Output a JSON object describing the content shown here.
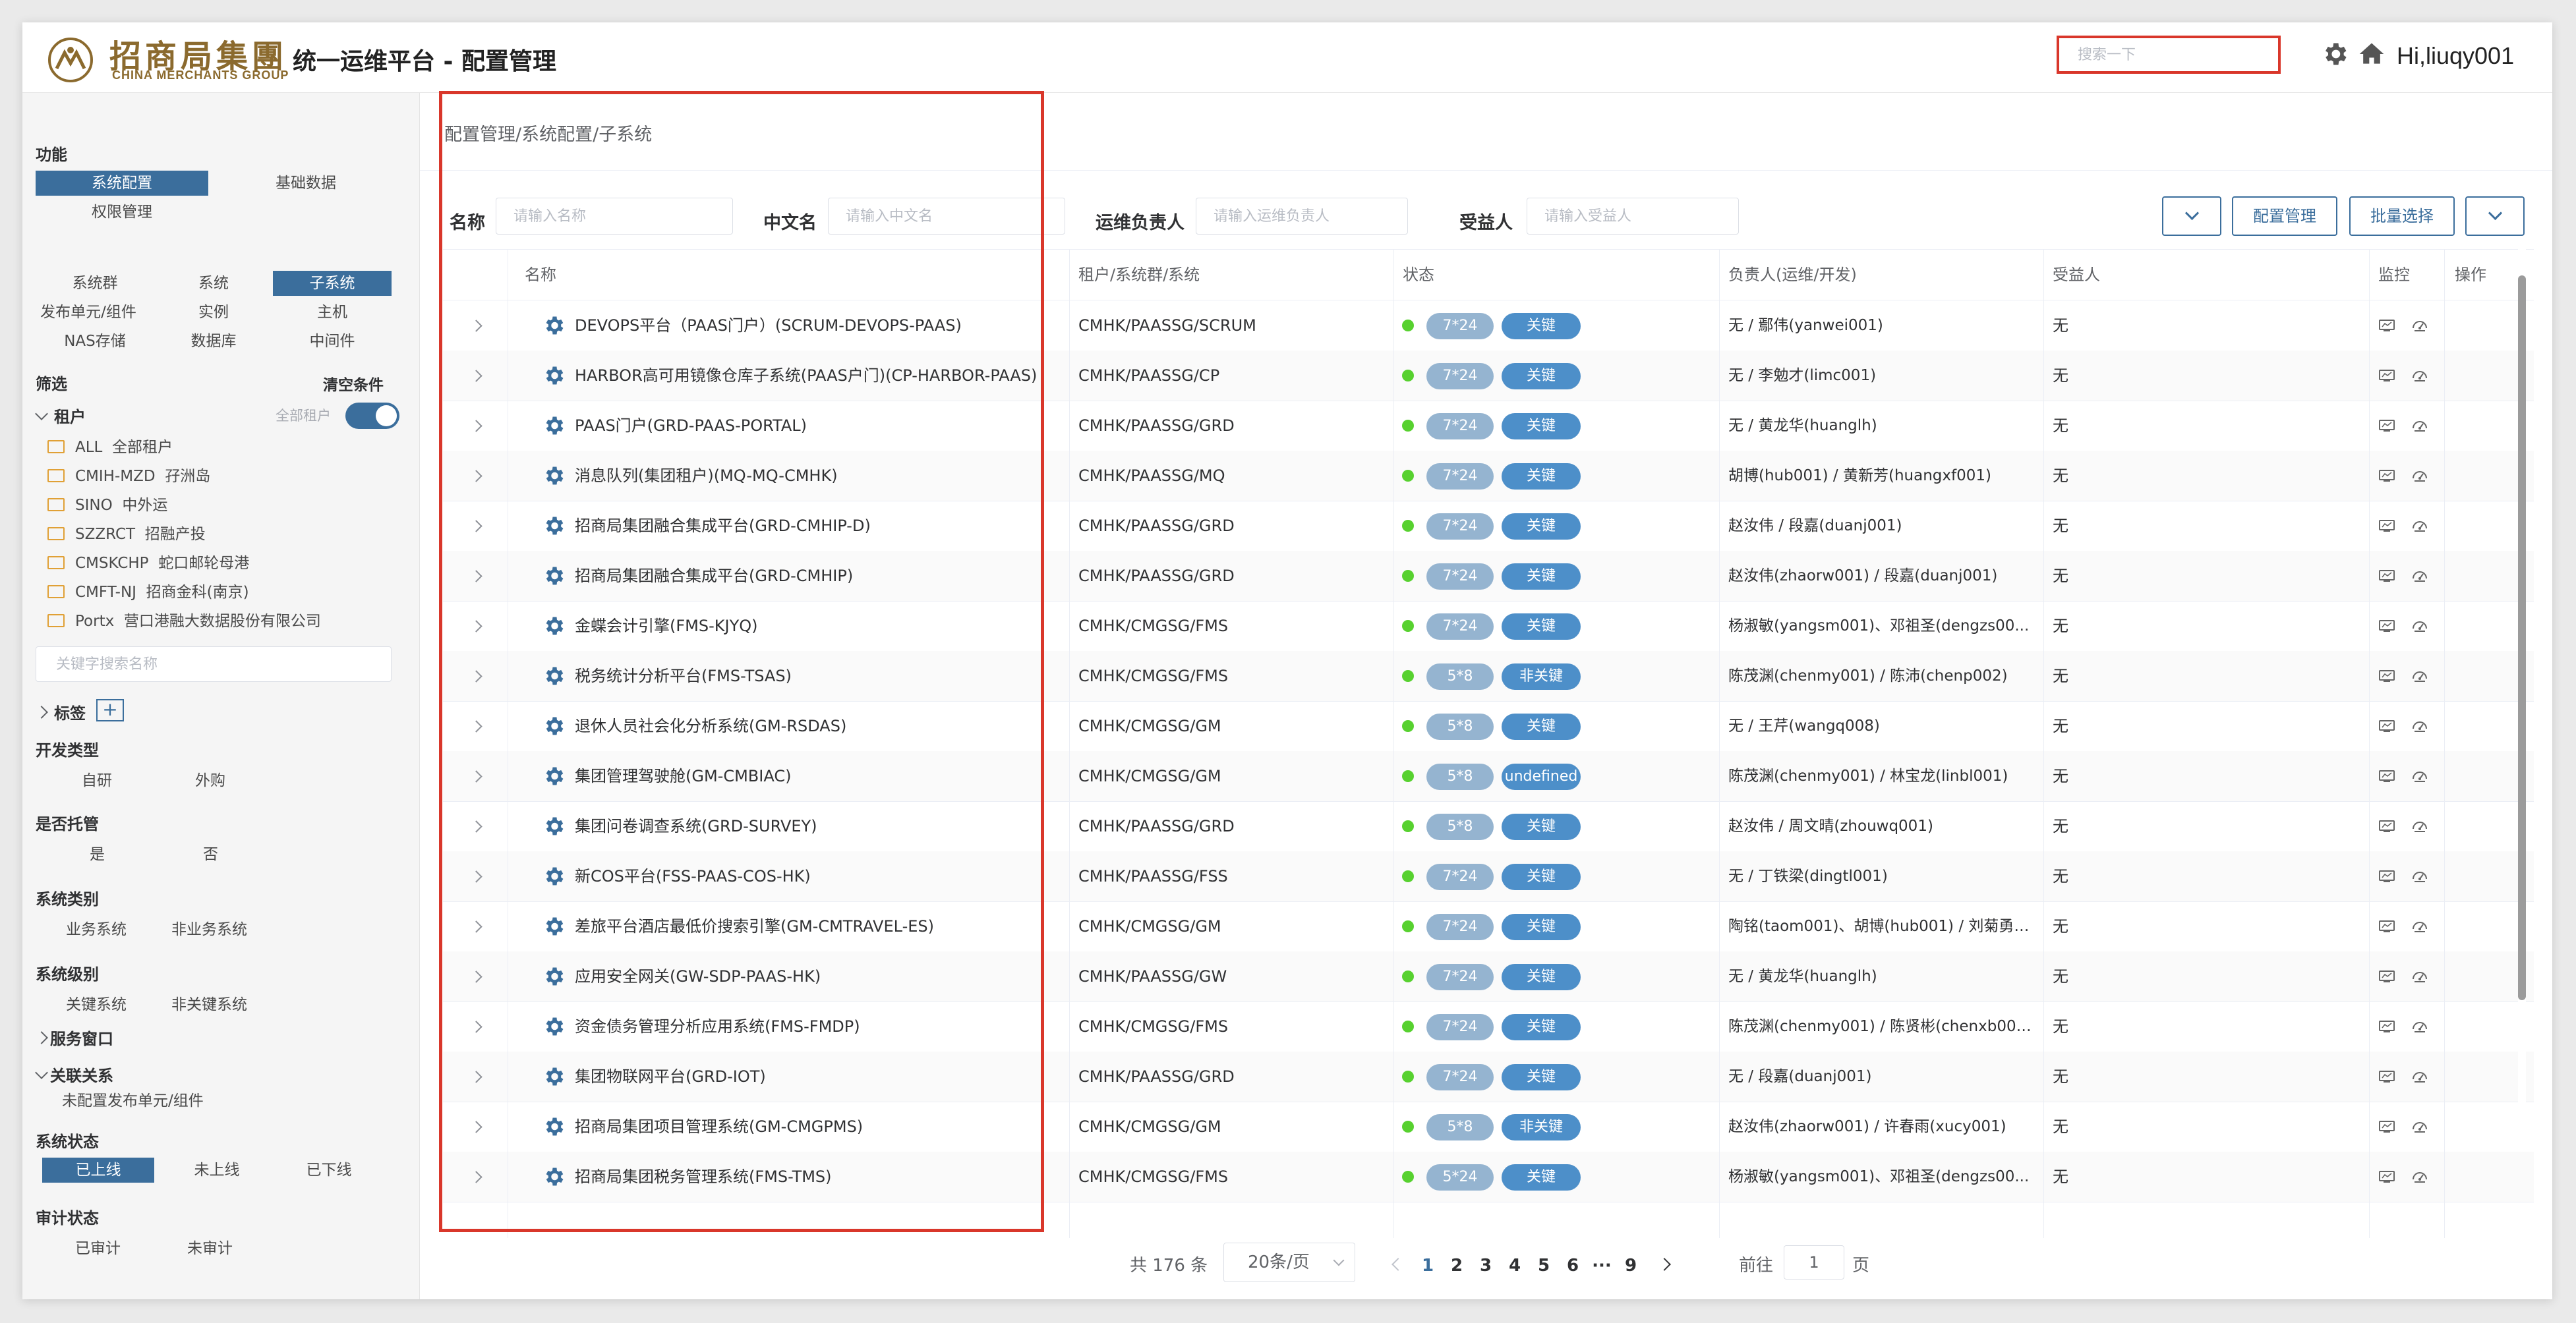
{
  "header": {
    "logo_cn": "招商局集團",
    "logo_en": "CHINA MERCHANTS GROUP",
    "title": "统一运维平台 - 配置管理",
    "search_placeholder": "搜索一下",
    "user": "Hi,liuqy001"
  },
  "sidebar": {
    "func_label": "功能",
    "func_items": [
      "系统配置",
      "基础数据",
      "权限管理"
    ],
    "nav_items": [
      "系统群",
      "系统",
      "子系统",
      "发布单元/组件",
      "实例",
      "主机",
      "NAS存储",
      "数据库",
      "中间件"
    ],
    "filter_label": "筛选",
    "clear_label": "清空条件",
    "tenant_label": "租户",
    "all_tenants_label": "全部租户",
    "tenants": [
      {
        "code": "ALL",
        "name": "全部租户"
      },
      {
        "code": "CMIH-MZD",
        "name": "孖洲岛"
      },
      {
        "code": "SINO",
        "name": "中外运"
      },
      {
        "code": "SZZRCT",
        "name": "招融产投"
      },
      {
        "code": "CMSKCHP",
        "name": "蛇口邮轮母港"
      },
      {
        "code": "CMFT-NJ",
        "name": "招商金科(南京)"
      },
      {
        "code": "Portx",
        "name": "营口港融大数据股份有限公司"
      }
    ],
    "keyword_placeholder": "关键字搜索名称",
    "tag_label": "标签",
    "dev_type_label": "开发类型",
    "dev_types": [
      "自研",
      "外购"
    ],
    "hosted_label": "是否托管",
    "hosted_opts": [
      "是",
      "否"
    ],
    "sys_cat_label": "系统类别",
    "sys_cats": [
      "业务系统",
      "非业务系统"
    ],
    "sys_level_label": "系统级别",
    "sys_levels": [
      "关键系统",
      "非关键系统"
    ],
    "service_window_label": "服务窗口",
    "relation_label": "关联关系",
    "relation_item": "未配置发布单元/组件",
    "sys_status_label": "系统状态",
    "sys_statuses": [
      "已上线",
      "未上线",
      "已下线"
    ],
    "audit_label": "审计状态",
    "audit_statuses": [
      "已审计",
      "未审计"
    ]
  },
  "main": {
    "breadcrumb": "配置管理/系统配置/子系统",
    "filters": {
      "name_label": "名称",
      "name_ph": "请输入名称",
      "cn_label": "中文名",
      "cn_ph": "请输入中文名",
      "ops_label": "运维负责人",
      "ops_ph": "请输入运维负责人",
      "benef_label": "受益人",
      "benef_ph": "请输入受益人"
    },
    "buttons": {
      "config": "配置管理",
      "batch": "批量选择"
    },
    "columns": [
      "名称",
      "租户/系统群/系统",
      "状态",
      "负责人(运维/开发)",
      "受益人",
      "监控",
      "操作"
    ],
    "rows": [
      {
        "name": "DEVOPS平台（PAAS门户）(SCRUM-DEVOPS-PAAS)",
        "path": "CMHK/PAASSG/SCRUM",
        "sla": "7*24",
        "tag": "关键",
        "owner": "无 / 鄢伟(yanwei001)",
        "benef": "无"
      },
      {
        "name": "HARBOR高可用镜像仓库子系统(PAAS户门)(CP-HARBOR-PAAS)",
        "path": "CMHK/PAASSG/CP",
        "sla": "7*24",
        "tag": "关键",
        "owner": "无 / 李勉才(limc001)",
        "benef": "无"
      },
      {
        "name": "PAAS门户(GRD-PAAS-PORTAL)",
        "path": "CMHK/PAASSG/GRD",
        "sla": "7*24",
        "tag": "关键",
        "owner": "无 / 黄龙华(huanglh)",
        "benef": "无"
      },
      {
        "name": "消息队列(集团租户)(MQ-MQ-CMHK)",
        "path": "CMHK/PAASSG/MQ",
        "sla": "7*24",
        "tag": "关键",
        "owner": "胡博(hub001) / 黄新芳(huangxf001)",
        "benef": "无"
      },
      {
        "name": "招商局集团融合集成平台(GRD-CMHIP-D)",
        "path": "CMHK/PAASSG/GRD",
        "sla": "7*24",
        "tag": "关键",
        "owner": "赵汝伟 / 段嘉(duanj001)",
        "benef": "无"
      },
      {
        "name": "招商局集团融合集成平台(GRD-CMHIP)",
        "path": "CMHK/PAASSG/GRD",
        "sla": "7*24",
        "tag": "关键",
        "owner": "赵汝伟(zhaorw001) / 段嘉(duanj001)",
        "benef": "无"
      },
      {
        "name": "金蝶会计引擎(FMS-KJYQ)",
        "path": "CMHK/CMGSG/FMS",
        "sla": "7*24",
        "tag": "关键",
        "owner": "杨淑敏(yangsm001)、邓祖圣(dengzs00...",
        "benef": "无"
      },
      {
        "name": "税务统计分析平台(FMS-TSAS)",
        "path": "CMHK/CMGSG/FMS",
        "sla": "5*8",
        "tag": "非关键",
        "owner": "陈茂渊(chenmy001) / 陈沛(chenp002)",
        "benef": "无"
      },
      {
        "name": "退休人员社会化分析系统(GM-RSDAS)",
        "path": "CMHK/CMGSG/GM",
        "sla": "5*8",
        "tag": "关键",
        "owner": "无 / 王芹(wangq008)",
        "benef": "无"
      },
      {
        "name": "集团管理驾驶舱(GM-CMBIAC)",
        "path": "CMHK/CMGSG/GM",
        "sla": "5*8",
        "tag": "undefined",
        "owner": "陈茂渊(chenmy001) / 林宝龙(linbl001)",
        "benef": "无"
      },
      {
        "name": "集团问卷调查系统(GRD-SURVEY)",
        "path": "CMHK/PAASSG/GRD",
        "sla": "5*8",
        "tag": "关键",
        "owner": "赵汝伟 / 周文晴(zhouwq001)",
        "benef": "无"
      },
      {
        "name": "新COS平台(FSS-PAAS-COS-HK)",
        "path": "CMHK/PAASSG/FSS",
        "sla": "7*24",
        "tag": "关键",
        "owner": "无 / 丁铁梁(dingtl001)",
        "benef": "无"
      },
      {
        "name": "差旅平台酒店最低价搜索引擎(GM-CMTRAVEL-ES)",
        "path": "CMHK/CMGSG/GM",
        "sla": "7*24",
        "tag": "关键",
        "owner": "陶铭(taom001)、胡博(hub001) / 刘菊勇(l...",
        "benef": "无"
      },
      {
        "name": "应用安全网关(GW-SDP-PAAS-HK)",
        "path": "CMHK/PAASSG/GW",
        "sla": "7*24",
        "tag": "关键",
        "owner": "无 / 黄龙华(huanglh)",
        "benef": "无"
      },
      {
        "name": "资金债务管理分析应用系统(FMS-FMDP)",
        "path": "CMHK/CMGSG/FMS",
        "sla": "7*24",
        "tag": "关键",
        "owner": "陈茂渊(chenmy001) / 陈贤彬(chenxb002)",
        "benef": "无"
      },
      {
        "name": "集团物联网平台(GRD-IOT)",
        "path": "CMHK/PAASSG/GRD",
        "sla": "7*24",
        "tag": "关键",
        "owner": "无 / 段嘉(duanj001)",
        "benef": "无"
      },
      {
        "name": "招商局集团项目管理系统(GM-CMGPMS)",
        "path": "CMHK/CMGSG/GM",
        "sla": "5*8",
        "tag": "非关键",
        "owner": "赵汝伟(zhaorw001) / 许春雨(xucy001)",
        "benef": "无"
      },
      {
        "name": "招商局集团税务管理系统(FMS-TMS)",
        "path": "CMHK/CMGSG/FMS",
        "sla": "5*24",
        "tag": "关键",
        "owner": "杨淑敏(yangsm001)、邓祖圣(dengzs00...",
        "benef": "无"
      }
    ],
    "pagination": {
      "total": "共 176 条",
      "page_size": "20条/页",
      "pages": [
        "1",
        "2",
        "3",
        "4",
        "5",
        "6",
        "···",
        "9"
      ],
      "goto_label": "前往",
      "goto_value": "1",
      "page_suffix": "页"
    }
  },
  "colors": {
    "primary": "#3b6e9c",
    "highlight": "#d9372b",
    "status_green": "#57d12f",
    "sla_pill": "#95b4d0",
    "tag_pill": "#4d8fc9",
    "gear": "#3b6e9c"
  }
}
